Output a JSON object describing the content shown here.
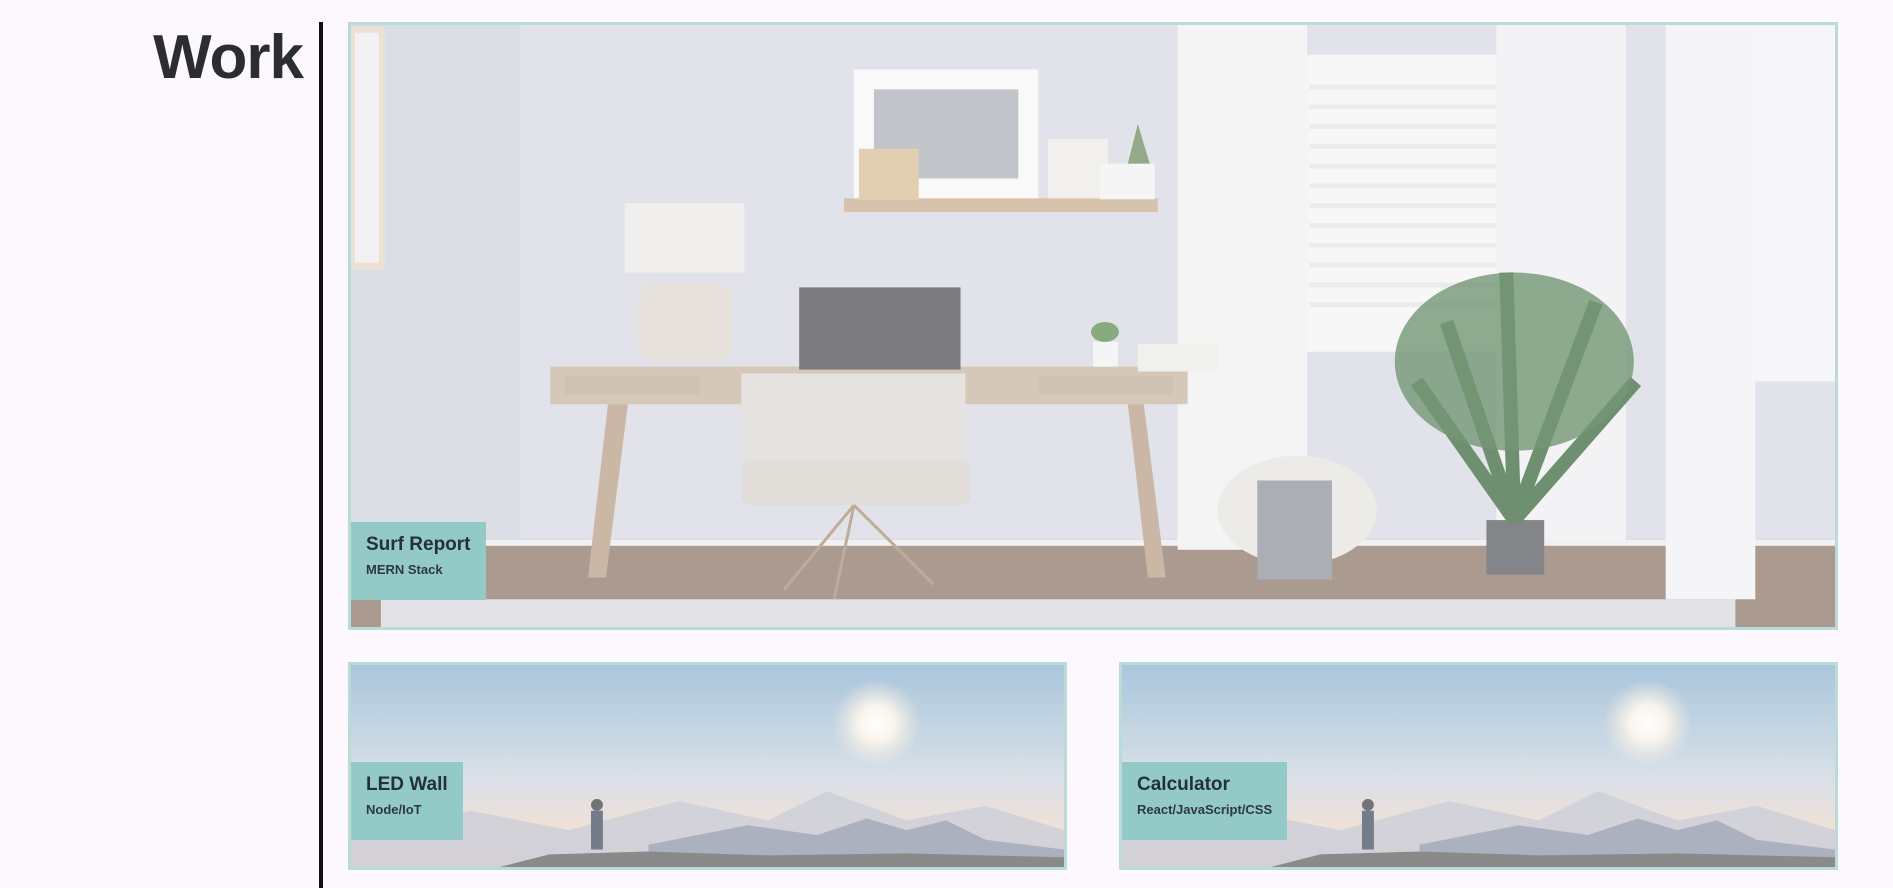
{
  "section": {
    "title": "Work"
  },
  "projects": [
    {
      "title": "Surf Report",
      "stack": "MERN Stack",
      "image": "home-office-desk-photo"
    },
    {
      "title": "LED Wall",
      "stack": "Node/IoT",
      "image": "hiker-mountain-sunrise-photo"
    },
    {
      "title": "Calculator",
      "stack": "React/JavaScript/CSS",
      "image": "hiker-mountain-sunrise-photo"
    }
  ],
  "colors": {
    "background": "#fdf8fe",
    "card_border": "#b9dcd9",
    "label_background": "#93c9c6",
    "title_text": "#2b2d33",
    "divider": "#111111"
  }
}
